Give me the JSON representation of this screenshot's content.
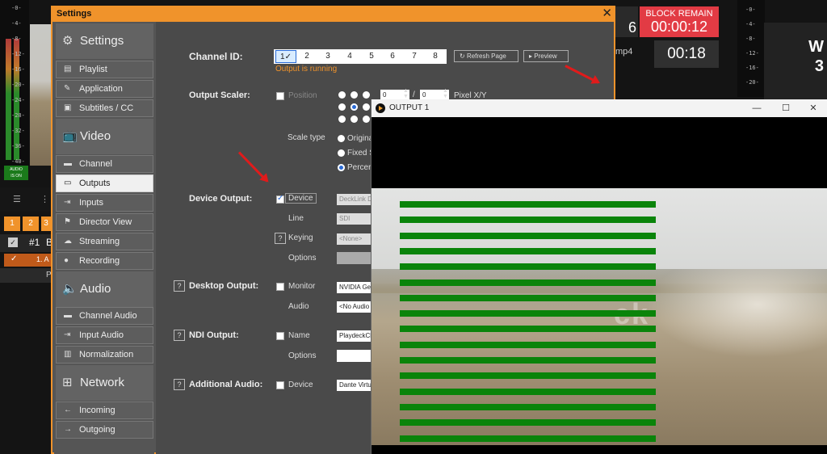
{
  "background_app": {
    "meter_left_ticks": [
      "-0-",
      "-4-",
      "-8-",
      "-12-",
      "-16-",
      "-20-",
      "-24-",
      "-28-",
      "-32-",
      "-36-",
      "-40-"
    ],
    "meter_right_ticks": [
      "-0-",
      "-4-",
      "-8-",
      "-12-",
      "-16-",
      "-20-"
    ],
    "audio_badge": "AUDIO\nIS ON",
    "tabs": [
      "1",
      "2",
      "3"
    ],
    "playlist_number": "#1",
    "playlist_title_partial": "B",
    "playlist_item": "1. A",
    "playlist_footer": "P",
    "block_remain_label": "BLOCK REMAIN",
    "block_remain_time": "00:00:12",
    "partial_digit": "6",
    "clip_suffix": "mp4",
    "clip_time": "00:18",
    "right_preview_partial": "W\n3"
  },
  "settings": {
    "window_title": "Settings",
    "close_glyph": "✕",
    "sidebar": {
      "groups": [
        {
          "heading": "Settings",
          "icon": "gear-icon",
          "items": [
            {
              "label": "Playlist",
              "icon": "document-icon"
            },
            {
              "label": "Application",
              "icon": "wrench-icon"
            },
            {
              "label": "Subtitles / CC",
              "icon": "subtitles-icon"
            }
          ]
        },
        {
          "heading": "Video",
          "icon": "tv-icon",
          "items": [
            {
              "label": "Channel",
              "icon": "channel-icon"
            },
            {
              "label": "Outputs",
              "icon": "monitor-icon",
              "active": true
            },
            {
              "label": "Inputs",
              "icon": "input-icon"
            },
            {
              "label": "Director View",
              "icon": "director-icon"
            },
            {
              "label": "Streaming",
              "icon": "streaming-icon"
            },
            {
              "label": "Recording",
              "icon": "record-icon"
            }
          ]
        },
        {
          "heading": "Audio",
          "icon": "speaker-icon",
          "items": [
            {
              "label": "Channel Audio",
              "icon": "channel-audio-icon"
            },
            {
              "label": "Input Audio",
              "icon": "input-audio-icon"
            },
            {
              "label": "Normalization",
              "icon": "normalization-icon"
            }
          ]
        },
        {
          "heading": "Network",
          "icon": "network-icon",
          "items": [
            {
              "label": "Incoming",
              "icon": "arrow-left-icon"
            },
            {
              "label": "Outgoing",
              "icon": "arrow-right-icon"
            }
          ]
        }
      ]
    },
    "content": {
      "channel_id_label": "Channel ID:",
      "channels": [
        "1✓",
        "2",
        "3",
        "4",
        "5",
        "6",
        "7",
        "8"
      ],
      "refresh_button": "Refresh Page",
      "preview_button": "Preview",
      "status_text": "Output is running",
      "output_scaler_label": "Output Scaler:",
      "position_label": "Position",
      "position_x": "0",
      "position_sep": "/",
      "position_y": "0",
      "pixel_label": "Pixel X/Y",
      "scale_type_label": "Scale type",
      "scale_options": [
        "Origina",
        "Fixed S",
        "Percent"
      ],
      "device_output_label": "Device Output:",
      "device_checkbox_label": "Device",
      "device_value": "DeckLink D",
      "line_label": "Line",
      "line_value": "SDI",
      "keying_label": "Keying",
      "keying_value": "<None>",
      "options_label": "Options",
      "desktop_output_label": "Desktop Output:",
      "monitor_label": "Monitor",
      "monitor_value": "NVIDIA GeF",
      "audio_label": "Audio",
      "audio_value": "<No Audio",
      "ndi_output_label": "NDI Output:",
      "name_label": "Name",
      "ndi_name_value": "PlaydeckCh",
      "ndi_options_label": "Options",
      "additional_audio_label": "Additional Audio:",
      "additional_device_label": "Device",
      "additional_device_value": "Dante Virtu",
      "help_glyph": "?"
    }
  },
  "output_window": {
    "title": "OUTPUT 1",
    "minimize_glyph": "—",
    "maximize_glyph": "☐",
    "close_glyph": "✕",
    "watermark_partial": "ck",
    "stripe_count": 16
  },
  "colors": {
    "accent_orange": "#f0932b",
    "block_remain_red": "#e23b44",
    "status_orange": "#f0932b",
    "stripe_green": "#0a840a",
    "annotation_red": "#e01b1b",
    "selection_blue": "#2a6bd6"
  }
}
